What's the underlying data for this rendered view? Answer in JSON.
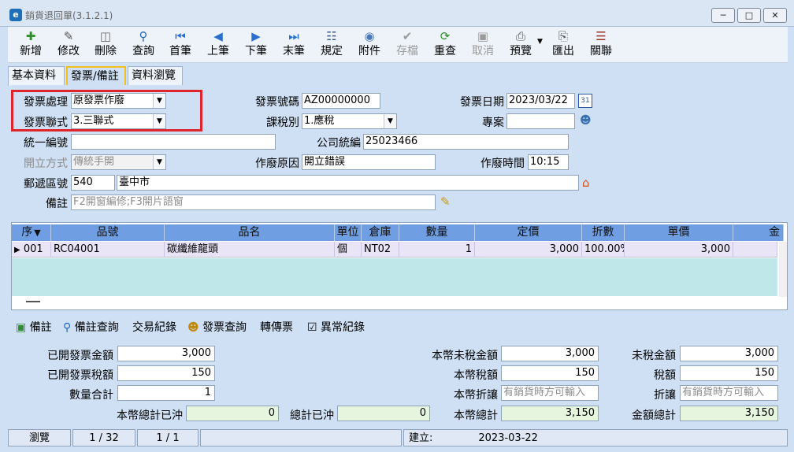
{
  "window": {
    "title": "銷貨退回單(3.1.2.1)",
    "min_glyph": "─",
    "max_glyph": "□",
    "close_glyph": "✕"
  },
  "toolbar": {
    "new": "新增",
    "edit": "修改",
    "delete": "刪除",
    "query": "查詢",
    "first": "首筆",
    "prev": "上筆",
    "next": "下筆",
    "last": "末筆",
    "spec": "規定",
    "attach": "附件",
    "save": "存檔",
    "recheck": "重查",
    "cancel": "取消",
    "preview": "預覽",
    "export": "匯出",
    "related": "關聯"
  },
  "tabs": {
    "basic": "基本資料",
    "invoice": "發票/備註",
    "browse": "資料瀏覽"
  },
  "form": {
    "invoice_handling_label": "發票處理",
    "invoice_handling_value": "原發票作廢",
    "invoice_copy_label": "發票聯式",
    "invoice_copy_value": "3.三聯式",
    "invoice_no_label": "發票號碼",
    "invoice_no_value": "AZ00000000",
    "tax_type_label": "課稅別",
    "tax_type_value": "1.應稅",
    "invoice_date_label": "發票日期",
    "invoice_date_value": "2023/03/22",
    "calendar_text": "31",
    "project_label": "專案",
    "project_value": "",
    "uniform_no_label": "統一編號",
    "uniform_no_value": "",
    "company_no_label": "公司統編",
    "company_no_value": "25023466",
    "issue_method_label": "開立方式",
    "issue_method_value": "傳統手開",
    "void_reason_label": "作廢原因",
    "void_reason_value": "開立錯誤",
    "void_time_label": "作廢時間",
    "void_time_value": "10:15",
    "postal_label": "郵遞區號",
    "postal_value": "540",
    "address_value": "臺中市",
    "note_label": "備註",
    "note_placeholder": "F2開窗編修;F3開片語窗"
  },
  "grid": {
    "headers": {
      "seq": "序",
      "item_no": "品號",
      "item_name": "品名",
      "unit": "單位",
      "warehouse": "倉庫",
      "qty": "數量",
      "list_price": "定價",
      "discount": "折數",
      "unit_price": "單價",
      "amount": "金"
    },
    "row": {
      "seq": "001",
      "item_no": "RC04001",
      "item_name": "碳纖維龍頭",
      "unit": "個",
      "warehouse": "NT02",
      "qty": "1",
      "list_price": "3,000",
      "discount": "100.00%",
      "unit_price": "3,000"
    }
  },
  "links": {
    "note": "備註",
    "note_query": "備註查詢",
    "txn_log": "交易紀錄",
    "invoice_query": "發票查詢",
    "transfer": "轉傳票",
    "anomaly": "異常紀錄"
  },
  "totals": {
    "issued_amount_label": "已開發票金額",
    "issued_amount_value": "3,000",
    "issued_tax_label": "已開發票稅額",
    "issued_tax_value": "150",
    "qty_total_label": "數量合計",
    "qty_total_value": "1",
    "local_total_offset_label": "本幣總計已沖",
    "local_total_offset_value": "0",
    "total_offset_label": "總計已沖",
    "total_offset_value": "0",
    "local_untaxed_label": "本幣未稅金額",
    "local_untaxed_value": "3,000",
    "local_tax_label": "本幣稅額",
    "local_tax_value": "150",
    "local_discount_label": "本幣折讓",
    "local_discount_placeholder": "有銷貨時方可輸入",
    "local_total_label": "本幣總計",
    "local_total_value": "3,150",
    "untaxed_label": "未稅金額",
    "untaxed_value": "3,000",
    "tax_label": "稅額",
    "tax_value": "150",
    "discount_label": "折讓",
    "discount_placeholder": "有銷貨時方可輸入",
    "grand_total_label": "金額總計",
    "grand_total_value": "3,150"
  },
  "status": {
    "mode": "瀏覽",
    "record_pos": "1 / 32",
    "page_pos": "1 / 1",
    "created": "建立:",
    "created_date": "2023-03-22"
  }
}
